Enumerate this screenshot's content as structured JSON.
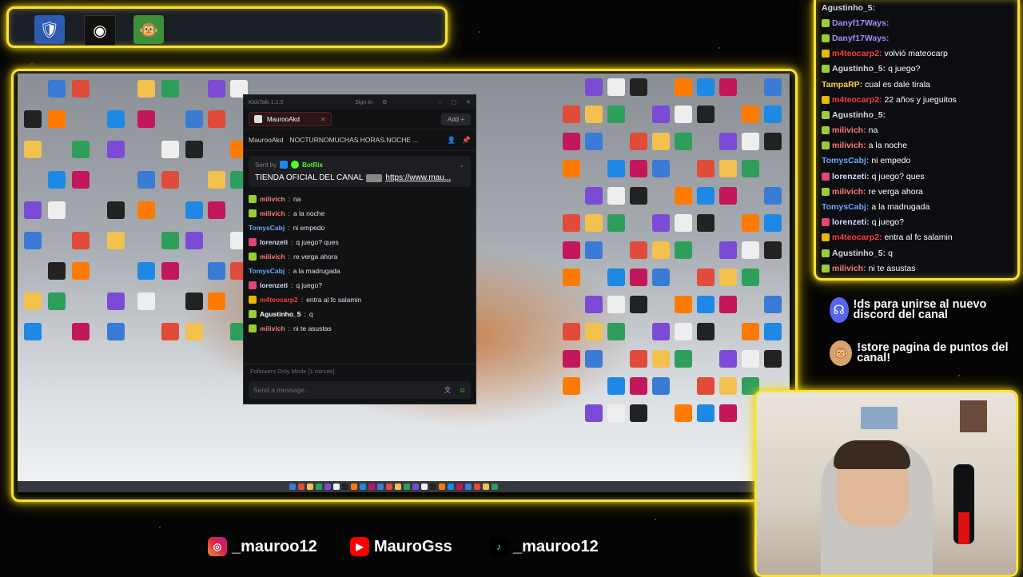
{
  "top_apps": [
    {
      "name": "emblem-app",
      "color": "#c9a33a"
    },
    {
      "name": "obs-app",
      "color": "#111111"
    },
    {
      "name": "monkey-app",
      "color": "#2f8d2f"
    }
  ],
  "kicktalk": {
    "title": "KickTalk 1.1.3",
    "sign_in": "Sign In",
    "tab": "MaurooAkd",
    "add": "Add",
    "channel": "MaurooAkd",
    "stream_title": "NOCTURNOMUCHAS HORAS.NOCHE ...",
    "pinned": {
      "sent_by": "Sent by",
      "bot": "BotRix",
      "text": "TIENDA OFICIAL DEL CANAL",
      "link": "https://www.mau..."
    },
    "messages": [
      {
        "user": "milivich",
        "color": "#ff7777",
        "text": "na",
        "badge": "#9acd32"
      },
      {
        "user": "milivich",
        "color": "#ff7777",
        "text": "a la noche",
        "badge": "#9acd32"
      },
      {
        "user": "TomysCabj",
        "color": "#6aa9ff",
        "text": "ni empedo",
        "badge": ""
      },
      {
        "user": "lorenzeti",
        "color": "#d9d9ff",
        "text": "q juego? ques",
        "badge": "#e0457b"
      },
      {
        "user": "milivich",
        "color": "#ff7777",
        "text": "re verga ahora",
        "badge": "#9acd32"
      },
      {
        "user": "TomysCabj",
        "color": "#6aa9ff",
        "text": "a la madrugada",
        "badge": ""
      },
      {
        "user": "lorenzeti",
        "color": "#d9d9ff",
        "text": "q juego?",
        "badge": "#e0457b"
      },
      {
        "user": "m4teocarp2",
        "color": "#ff3b3b",
        "text": "entra al fc salamin",
        "badge": "#e6b800"
      },
      {
        "user": "Agustinho_5",
        "color": "#ffffff",
        "text": "q",
        "badge": "#9acd32"
      },
      {
        "user": "milivich",
        "color": "#ff7777",
        "text": "ni te asustas",
        "badge": "#9acd32"
      }
    ],
    "followers_mode": "Followers Only Mode [1 minute]",
    "input_placeholder": "Send a message..."
  },
  "chat": [
    {
      "user": "Agustinho_5:",
      "color": "#d9d9d9",
      "text": "",
      "badge": ""
    },
    {
      "user": "Danyf17Ways:",
      "color": "#a78bfa",
      "text": "",
      "badge": "#9acd32"
    },
    {
      "user": "Danyf17Ways:",
      "color": "#a78bfa",
      "text": "",
      "badge": "#9acd32"
    },
    {
      "user": "m4teocarp2:",
      "color": "#ff3b3b",
      "text": "volvió mateocarp",
      "badge": "#e6b800"
    },
    {
      "user": "Agustinho_5:",
      "color": "#d9d9d9",
      "text": "q juego?",
      "badge": "#9acd32"
    },
    {
      "user": "TampaRP:",
      "color": "#ffcf4a",
      "text": "cual es dale tirala",
      "badge": ""
    },
    {
      "user": "m4teocarp2:",
      "color": "#ff3b3b",
      "text": "22 años y jueguitos",
      "badge": "#e6b800"
    },
    {
      "user": "Agustinho_5:",
      "color": "#d9d9d9",
      "text": "",
      "badge": "#9acd32"
    },
    {
      "user": "milivich:",
      "color": "#ff7777",
      "text": "na",
      "badge": "#9acd32"
    },
    {
      "user": "milivich:",
      "color": "#ff7777",
      "text": "a la noche",
      "badge": "#9acd32"
    },
    {
      "user": "TomysCabj:",
      "color": "#6aa9ff",
      "text": "ni empedo",
      "badge": ""
    },
    {
      "user": "lorenzeti:",
      "color": "#d9d9ff",
      "text": "q juego? ques",
      "badge": "#e0457b"
    },
    {
      "user": "milivich:",
      "color": "#ff7777",
      "text": "re verga ahora",
      "badge": "#9acd32"
    },
    {
      "user": "TomysCabj:",
      "color": "#6aa9ff",
      "text": "a la madrugada",
      "badge": ""
    },
    {
      "user": "lorenzeti:",
      "color": "#d9d9ff",
      "text": "q juego?",
      "badge": "#e0457b"
    },
    {
      "user": "m4teocarp2:",
      "color": "#ff3b3b",
      "text": "entra al fc salamin",
      "badge": "#e6b800"
    },
    {
      "user": "Agustinho_5:",
      "color": "#d9d9d9",
      "text": "q",
      "badge": "#9acd32"
    },
    {
      "user": "milivich:",
      "color": "#ff7777",
      "text": "ni te asustas",
      "badge": "#9acd32"
    }
  ],
  "promos": [
    {
      "icon": "discord-icon",
      "color": "#5865f2",
      "text": "!ds para unirse al nuevo discord del canal"
    },
    {
      "icon": "store-icon",
      "color": "#d9a46b",
      "text": "!store pagina de puntos del canal!"
    }
  ],
  "socials": [
    {
      "icon": "instagram-icon",
      "text": "_mauroo12"
    },
    {
      "icon": "youtube-icon",
      "text": "MauroGss"
    },
    {
      "icon": "tiktok-icon",
      "text": "_mauroo12"
    }
  ],
  "colors": {
    "frame": "#f7e23a",
    "kick_green": "#53fc18"
  }
}
